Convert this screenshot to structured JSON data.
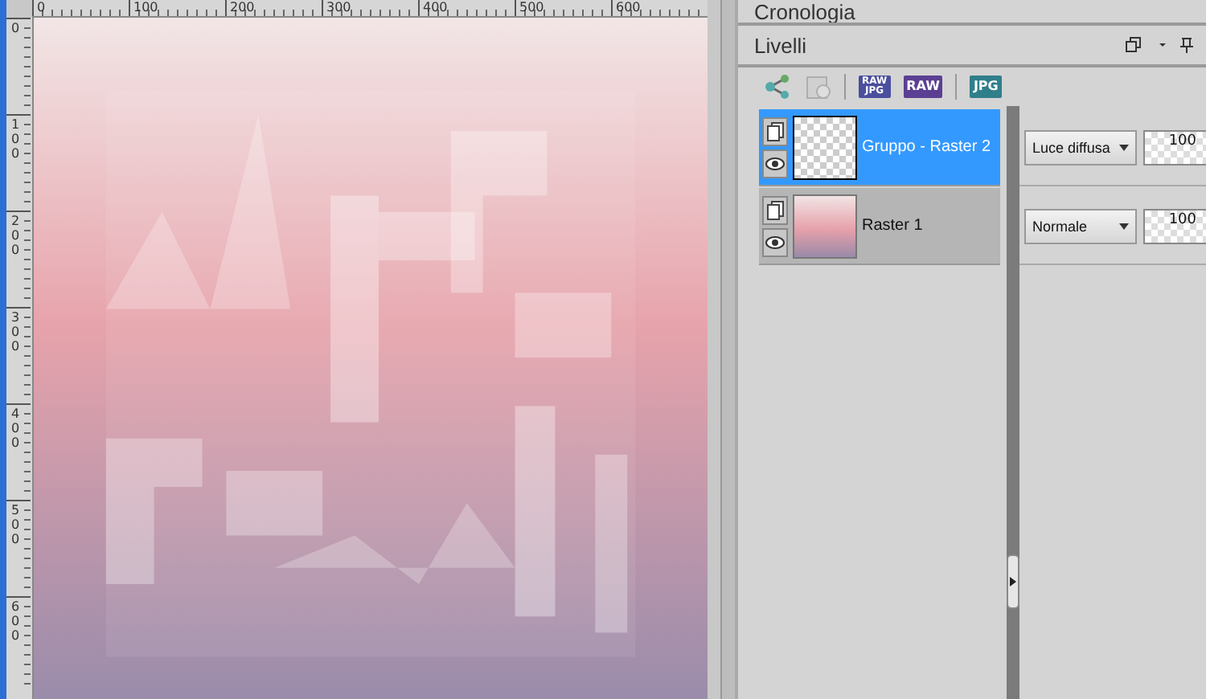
{
  "rulers": {
    "horizontal": [
      "0",
      "100",
      "200",
      "300",
      "400",
      "500",
      "600"
    ],
    "vertical": [
      "0",
      "100",
      "200",
      "300",
      "400",
      "500",
      "600"
    ]
  },
  "history_panel": {
    "title": "Cronologia"
  },
  "layers_panel": {
    "title": "Livelli",
    "toolbar": [
      {
        "kind": "share",
        "disabled": false
      },
      {
        "kind": "mask",
        "disabled": true
      },
      {
        "kind": "badge",
        "lines": [
          "RAW",
          "JPG"
        ],
        "color": "#4a4f9e"
      },
      {
        "kind": "badge",
        "lines": [
          "RAW"
        ],
        "color": "#5b3f93"
      },
      {
        "kind": "badge",
        "lines": [
          "JPG"
        ],
        "color": "#2f7f8a"
      }
    ],
    "layers": [
      {
        "name": "Gruppo - Raster 2",
        "selected": true,
        "visible": true,
        "kind": "group",
        "blend_mode": "Luce diffusa",
        "opacity": "100"
      },
      {
        "name": "Raster 1",
        "selected": false,
        "visible": true,
        "kind": "raster",
        "blend_mode": "Normale",
        "opacity": "100"
      }
    ]
  }
}
